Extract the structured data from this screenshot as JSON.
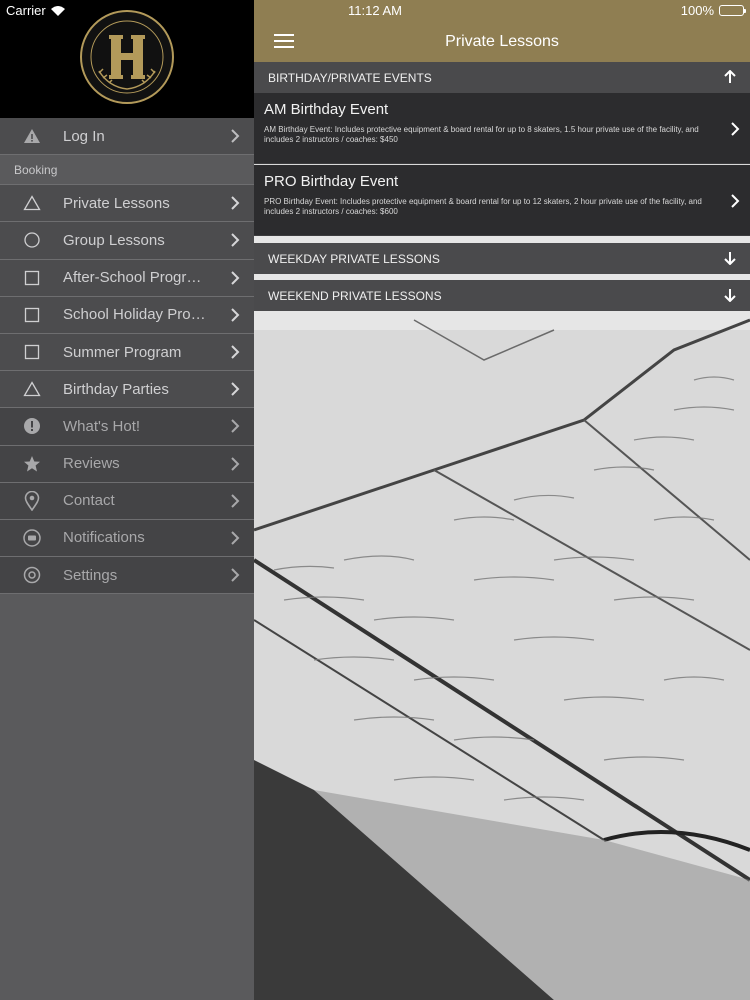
{
  "status": {
    "carrier": "Carrier",
    "time": "11:12 AM",
    "battery": "100%"
  },
  "header": {
    "title": "Private Lessons"
  },
  "sidebar": {
    "login": {
      "label": "Log In",
      "icon": "warning-icon"
    },
    "section_booking": "Booking",
    "booking_items": [
      {
        "label": "Private Lessons",
        "icon": "triangle-icon"
      },
      {
        "label": "Group Lessons",
        "icon": "circle-icon"
      },
      {
        "label": "After-School Progr…",
        "icon": "square-icon"
      },
      {
        "label": "School Holiday Pro…",
        "icon": "square-icon"
      },
      {
        "label": "Summer Program",
        "icon": "square-icon"
      },
      {
        "label": "Birthday Parties",
        "icon": "triangle-icon"
      }
    ],
    "other_items": [
      {
        "label": "What's Hot!",
        "icon": "exclamation-icon"
      },
      {
        "label": "Reviews",
        "icon": "star-icon"
      },
      {
        "label": "Contact",
        "icon": "location-pin-icon"
      },
      {
        "label": "Notifications",
        "icon": "chat-bubble-icon"
      },
      {
        "label": "Settings",
        "icon": "gear-icon"
      }
    ]
  },
  "sections": [
    {
      "title": "BIRTHDAY/PRIVATE EVENTS",
      "state": "expanded",
      "items": [
        {
          "title": "AM Birthday Event",
          "desc": "AM Birthday Event: Includes protective equipment & board rental for up to 8 skaters, 1.5 hour private use of the facility, and includes 2 instructors / coaches: $450"
        },
        {
          "title": "PRO Birthday Event",
          "desc": "PRO Birthday Event: Includes protective equipment & board rental for up to 12 skaters, 2 hour private use of the facility, and includes 2 instructors / coaches: $600"
        }
      ]
    },
    {
      "title": "WEEKDAY PRIVATE LESSONS",
      "state": "collapsed"
    },
    {
      "title": "WEEKEND PRIVATE LESSONS",
      "state": "collapsed"
    }
  ],
  "colors": {
    "header": "#8f7e52",
    "logo_gold": "#b39a5a"
  }
}
